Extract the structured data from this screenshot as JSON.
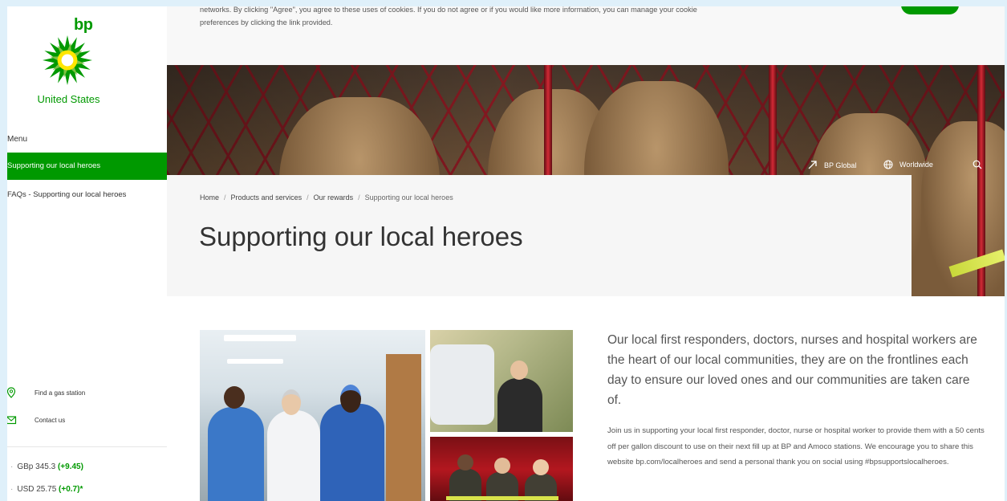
{
  "brand": {
    "logo_text": "bp",
    "country": "United States"
  },
  "sidebar": {
    "menu_label": "Menu",
    "items": [
      {
        "label": "Supporting our local heroes",
        "active": true
      },
      {
        "label": "FAQs - Supporting our local heroes",
        "active": false
      }
    ],
    "utilities": [
      {
        "label": "Find a gas station",
        "icon": "map-pin-icon"
      },
      {
        "label": "Contact us",
        "icon": "mail-icon"
      }
    ],
    "stocks": [
      {
        "label": "GBp 345.3",
        "change": "(+9.45)"
      },
      {
        "label": "USD 25.75",
        "change": "(+0.7)*"
      }
    ]
  },
  "cookie_banner": {
    "line1": "networks. By clicking \"Agree\", you agree to these uses of cookies. If you do not agree or if you would like more information, you can manage your cookie",
    "line2": "preferences by clicking the link provided."
  },
  "header_nav": {
    "global_link": "BP Global",
    "region": "Worldwide",
    "search_icon": "search-icon"
  },
  "breadcrumb": [
    "Home",
    "Products and services",
    "Our rewards",
    "Supporting our local heroes"
  ],
  "page_title": "Supporting our local heroes",
  "content": {
    "lead": "Our local first responders, doctors, nurses and hospital workers are the heart of our local communities, they are on the frontlines each day to ensure our loved ones and our communities are taken care of.",
    "body": "Join us in supporting your local first responder, doctor, nurse or hospital worker to provide them with a 50 cents off per gallon discount to use on their next fill up at BP and Amoco stations. We encourage you to share this website bp.com/localheroes and send a personal thank you on social using #bpsupportslocalheroes."
  },
  "colors": {
    "brand_green": "#009900",
    "brand_yellow": "#ffe600",
    "background": "#dff0fa"
  }
}
